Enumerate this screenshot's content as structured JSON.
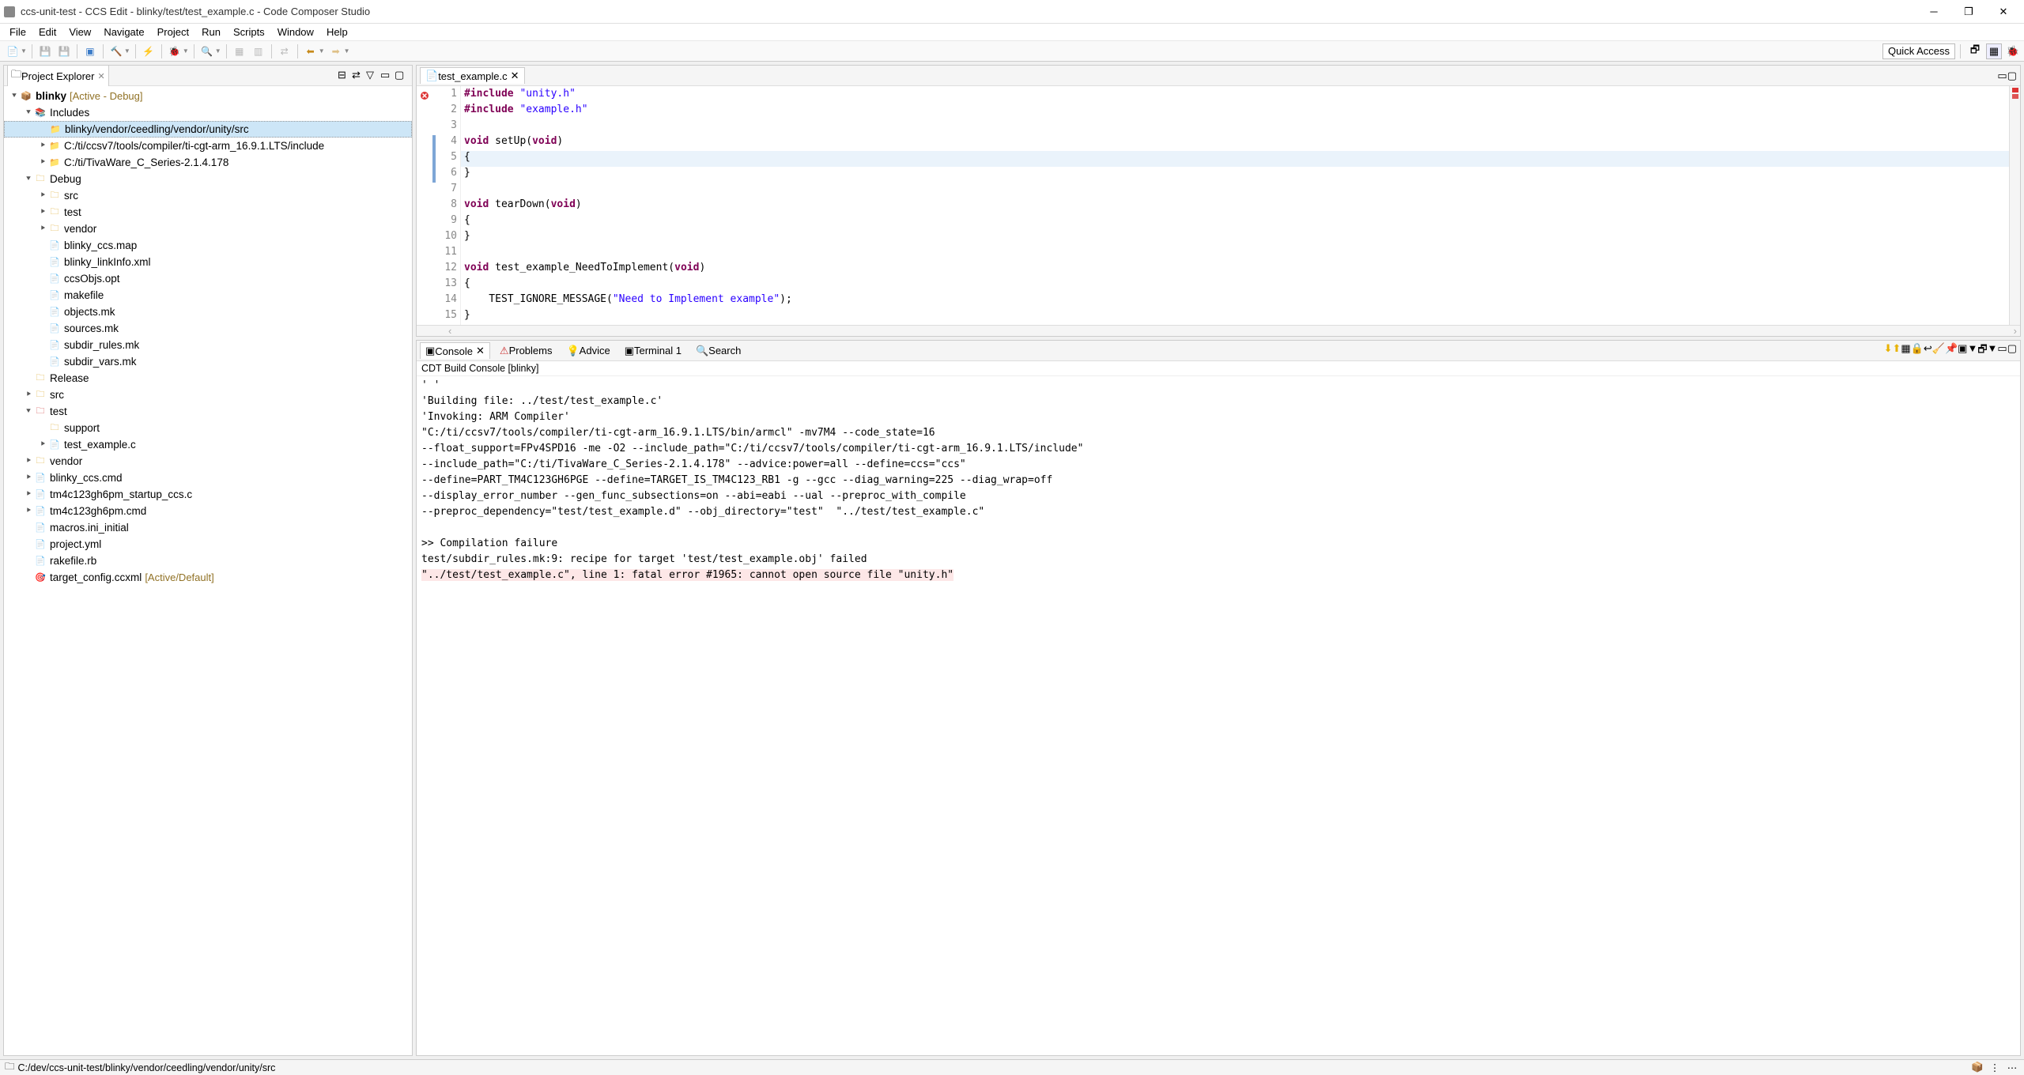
{
  "window": {
    "title": "ccs-unit-test - CCS Edit - blinky/test/test_example.c - Code Composer Studio"
  },
  "menu": [
    "File",
    "Edit",
    "View",
    "Navigate",
    "Project",
    "Run",
    "Scripts",
    "Window",
    "Help"
  ],
  "quickaccess": "Quick Access",
  "explorer": {
    "title": "Project Explorer",
    "project": "blinky",
    "project_status": "[Active - Debug]",
    "includes": "Includes",
    "inc": {
      "i0": "blinky/vendor/ceedling/vendor/unity/src",
      "i1": "C:/ti/ccsv7/tools/compiler/ti-cgt-arm_16.9.1.LTS/include",
      "i2": "C:/ti/TivaWare_C_Series-2.1.4.178"
    },
    "debug": "Debug",
    "dbg": {
      "src": "src",
      "test": "test",
      "vendor": "vendor",
      "map": "blinky_ccs.map",
      "link": "blinky_linkInfo.xml",
      "opt": "ccsObjs.opt",
      "make": "makefile",
      "obj": "objects.mk",
      "srcmk": "sources.mk",
      "subr": "subdir_rules.mk",
      "subv": "subdir_vars.mk"
    },
    "release": "Release",
    "srcf": "src",
    "testf": "test",
    "test": {
      "support": "support",
      "example": "test_example.c"
    },
    "vendorf": "vendor",
    "files": {
      "cmd": "blinky_ccs.cmd",
      "startup": "tm4c123gh6pm_startup_ccs.c",
      "tmcmd": "tm4c123gh6pm.cmd",
      "macros": "macros.ini_initial",
      "yml": "project.yml",
      "rake": "rakefile.rb",
      "target": "target_config.ccxml",
      "target_status": "[Active/Default]"
    }
  },
  "editor": {
    "tab": "test_example.c",
    "code": {
      "l1a": "#include",
      "l1b": " \"unity.h\"",
      "l2a": "#include",
      "l2b": " \"example.h\"",
      "l4a": "void",
      "l4b": " setUp(",
      "l4c": "void",
      "l4d": ")",
      "l5": "{",
      "l6": "}",
      "l8a": "void",
      "l8b": " tearDown(",
      "l8c": "void",
      "l8d": ")",
      "l9": "{",
      "l10": "}",
      "l12a": "void",
      "l12b": " test_example_NeedToImplement(",
      "l12c": "void",
      "l12d": ")",
      "l13": "{",
      "l14a": "    TEST_IGNORE_MESSAGE(",
      "l14b": "\"Need to Implement example\"",
      "l14c": ");",
      "l15": "}"
    }
  },
  "bottom": {
    "tabs": {
      "console": "Console",
      "problems": "Problems",
      "advice": "Advice",
      "terminal": "Terminal 1",
      "search": "Search"
    },
    "console_title": "CDT Build Console [blinky]",
    "out": "' '\n'Building file: ../test/test_example.c'\n'Invoking: ARM Compiler'\n\"C:/ti/ccsv7/tools/compiler/ti-cgt-arm_16.9.1.LTS/bin/armcl\" -mv7M4 --code_state=16\n--float_support=FPv4SPD16 -me -O2 --include_path=\"C:/ti/ccsv7/tools/compiler/ti-cgt-arm_16.9.1.LTS/include\"\n--include_path=\"C:/ti/TivaWare_C_Series-2.1.4.178\" --advice:power=all --define=ccs=\"ccs\"\n--define=PART_TM4C123GH6PGE --define=TARGET_IS_TM4C123_RB1 -g --gcc --diag_warning=225 --diag_wrap=off\n--display_error_number --gen_func_subsections=on --abi=eabi --ual --preproc_with_compile\n--preproc_dependency=\"test/test_example.d\" --obj_directory=\"test\"  \"../test/test_example.c\"\n\n>> Compilation failure\ntest/subdir_rules.mk:9: recipe for target 'test/test_example.obj' failed",
    "err": "\"../test/test_example.c\", line 1: fatal error #1965: cannot open source file \"unity.h\""
  },
  "status": {
    "path": "C:/dev/ccs-unit-test/blinky/vendor/ceedling/vendor/unity/src"
  }
}
